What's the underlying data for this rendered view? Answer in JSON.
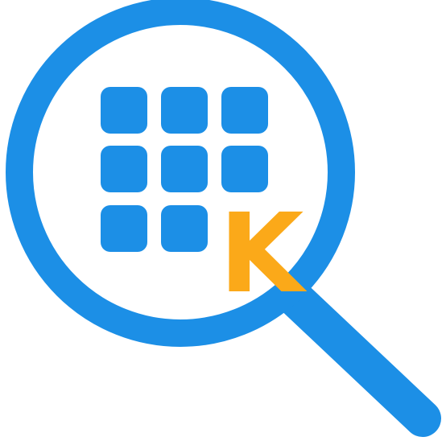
{
  "logo": {
    "letter": "K",
    "colors": {
      "ring": "#1c8fe6",
      "handle": "#1c8fe6",
      "keys": "#1c8fe6",
      "letter": "#fba919",
      "background": "#ffffff"
    },
    "icons": {
      "lens": "magnifier-lens-icon",
      "handle": "magnifier-handle-icon",
      "keypad": "keypad-grid-icon"
    }
  }
}
